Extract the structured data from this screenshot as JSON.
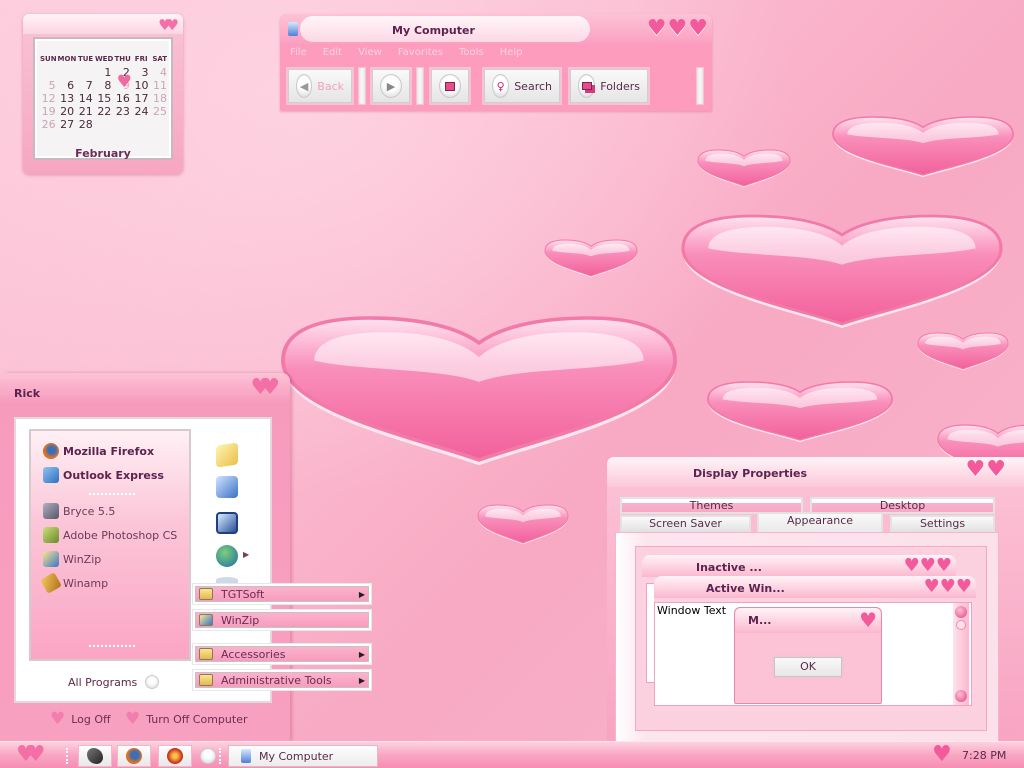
{
  "calendar": {
    "weekdays": [
      "SUN",
      "MON",
      "TUE",
      "WED",
      "THU",
      "FRI",
      "SAT"
    ],
    "weeks": [
      [
        "",
        "",
        "",
        "1",
        "2",
        "3",
        "4"
      ],
      [
        "5",
        "6",
        "7",
        "8",
        "9",
        "10",
        "11"
      ],
      [
        "12",
        "13",
        "14",
        "15",
        "16",
        "17",
        "18"
      ],
      [
        "19",
        "20",
        "21",
        "22",
        "23",
        "24",
        "25"
      ],
      [
        "26",
        "27",
        "28",
        "",
        "",
        "",
        ""
      ]
    ],
    "today": "9",
    "month": "February"
  },
  "explorer": {
    "title": "My Computer",
    "menu": [
      "File",
      "Edit",
      "View",
      "Favorites",
      "Tools",
      "Help"
    ],
    "toolbar": {
      "back_label": "Back",
      "search_label": "Search",
      "folders_label": "Folders"
    }
  },
  "start_menu": {
    "user": "Rick",
    "pinned": [
      {
        "label": "Mozilla Firefox",
        "icon": "firefox-icon"
      },
      {
        "label": "Outlook Express",
        "icon": "outlook-express-icon"
      }
    ],
    "recent": [
      {
        "label": "Bryce 5.5",
        "icon": "bryce-icon"
      },
      {
        "label": "Adobe Photoshop CS",
        "icon": "photoshop-icon"
      },
      {
        "label": "WinZip",
        "icon": "winzip-icon"
      },
      {
        "label": "Winamp",
        "icon": "winamp-icon"
      }
    ],
    "right_icons": [
      "my-documents-icon",
      "my-computer-icon",
      "control-panel-icon",
      "network-icon",
      "help-icon"
    ],
    "all_programs": "All Programs",
    "log_off": "Log Off",
    "turn_off": "Turn Off Computer"
  },
  "programs_submenu": {
    "items": [
      {
        "label": "TGTSoft",
        "has_submenu": true
      },
      {
        "label": "WinZip",
        "has_submenu": false
      },
      {
        "label": "Accessories",
        "has_submenu": true
      },
      {
        "label": "Administrative Tools",
        "has_submenu": true
      }
    ]
  },
  "display_properties": {
    "title": "Display Properties",
    "tabs_row1": [
      "Themes",
      "Desktop"
    ],
    "tabs_row2": [
      "Screen Saver",
      "Appearance",
      "Settings"
    ],
    "active_tab": "Appearance",
    "preview": {
      "inactive_title": "Inactive ...",
      "active_title": "Active Win...",
      "window_text": "Window Text",
      "message_title": "M...",
      "ok_label": "OK"
    }
  },
  "taskbar": {
    "quick_launch": [
      "gimp-icon",
      "firefox-icon",
      "media-player-icon"
    ],
    "tasks": [
      {
        "label": "My Computer",
        "icon": "my-computer-icon"
      }
    ],
    "clock": "7:28 PM"
  },
  "colors": {
    "accent": "#f25a9c",
    "background": "#fbbcd1",
    "title_text": "#5e2250"
  }
}
